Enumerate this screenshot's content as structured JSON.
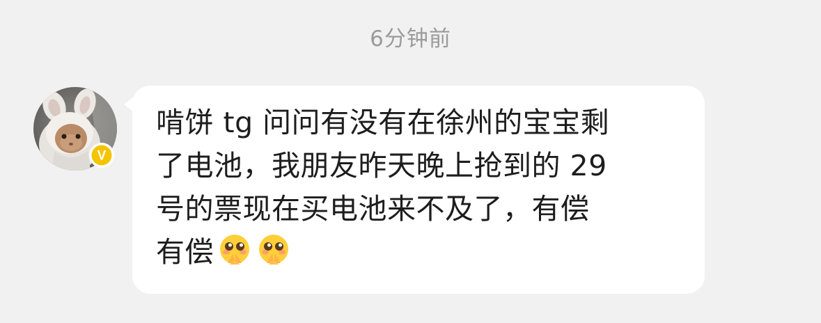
{
  "timestamp": "6分钟前",
  "message": {
    "sender_avatar_icon": "rabbit-avatar",
    "verified_badge_icon": "verified-v-icon",
    "verified_badge_letter": "V",
    "lines": [
      "啃饼 tg  问问有没有在徐州的宝宝剩",
      "了电池，我朋友昨天晚上抢到的 29",
      "号的票现在买电池来不及了，有偿",
      "有偿"
    ],
    "emojis": [
      "pleading-face-icon",
      "pleading-face-icon"
    ]
  },
  "colors": {
    "background": "#f1f1f1",
    "bubble": "#ffffff",
    "timestamp_text": "#9b9b9b",
    "message_text": "#1d1d1d",
    "verified_badge": "#f5c400"
  }
}
